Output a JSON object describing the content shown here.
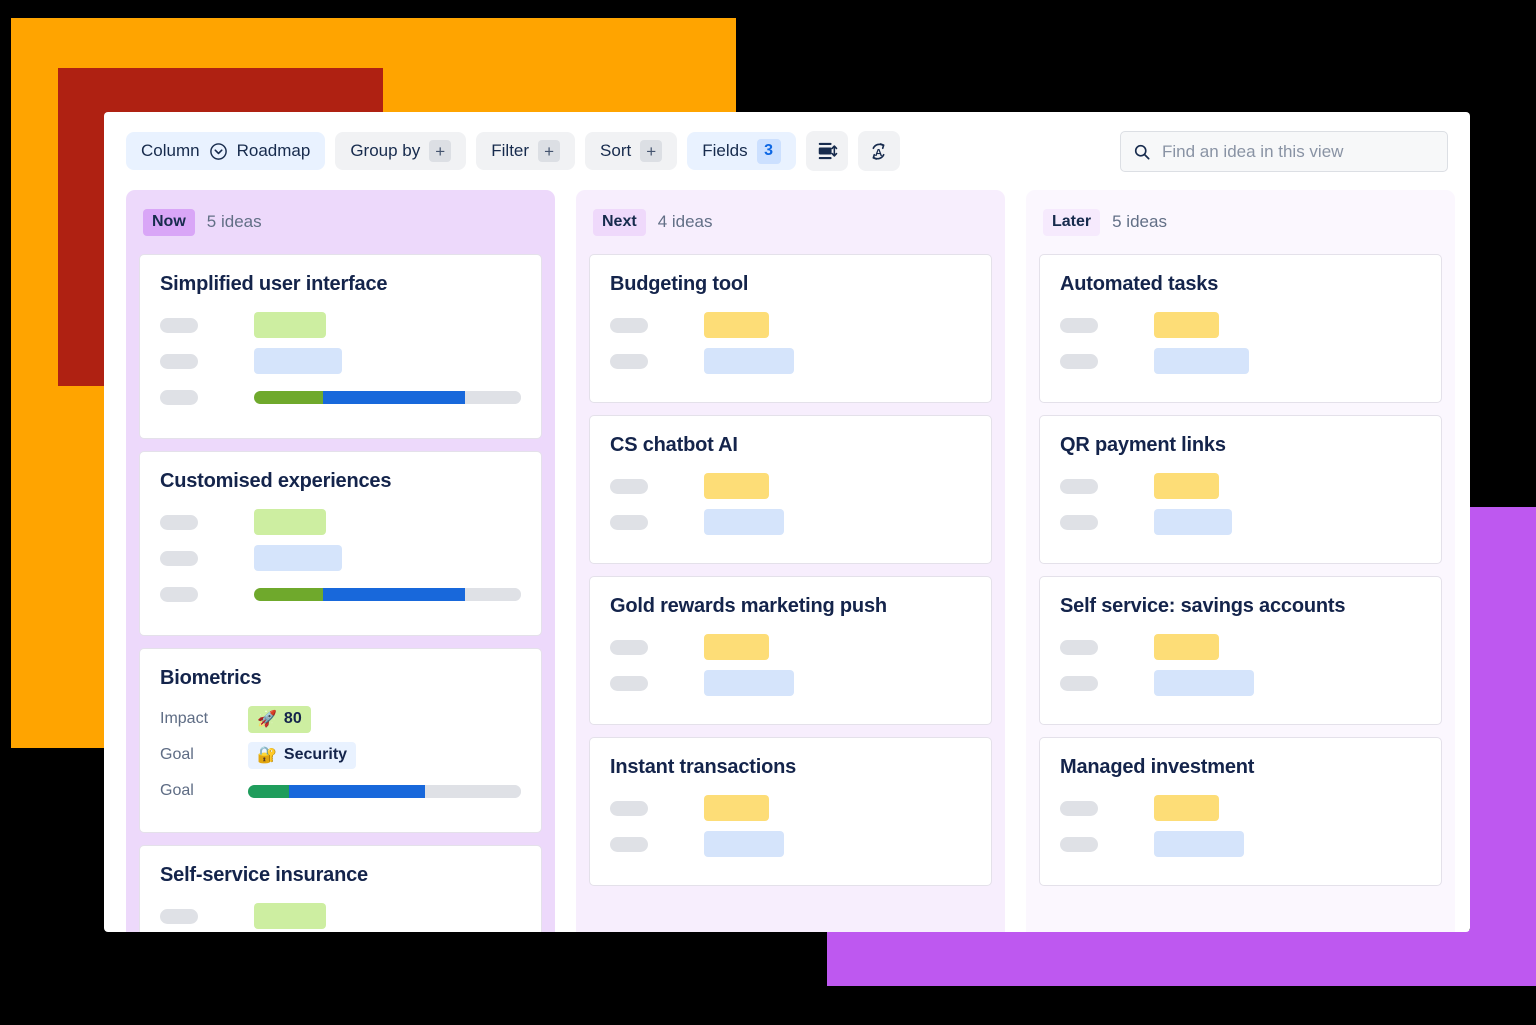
{
  "decor": {
    "orange": "#FFA400",
    "red": "#AF2112",
    "purple": "#BE58F0",
    "background": "#000000"
  },
  "toolbar": {
    "column_chip": {
      "label": "Column",
      "value": "Roadmap",
      "icon": "chevron-down-circle-icon"
    },
    "group_by": {
      "label": "Group by",
      "add": "+"
    },
    "filter": {
      "label": "Filter",
      "add": "+"
    },
    "sort": {
      "label": "Sort",
      "add": "+"
    },
    "fields": {
      "label": "Fields",
      "count": "3"
    },
    "row_height_icon": "row-height-icon",
    "translate_icon": "auto-translate-icon",
    "search": {
      "icon": "search-icon",
      "placeholder": "Find an idea in this view",
      "value": ""
    }
  },
  "board": {
    "columns": [
      {
        "key": "now",
        "badge": "Now",
        "count": "5 ideas",
        "cards": [
          {
            "title": "Simplified user interface",
            "rows": [
              {
                "label_kind": "skeleton",
                "value_kind": "pill",
                "pill_color": "green",
                "pill_width": 72
              },
              {
                "label_kind": "skeleton",
                "value_kind": "pill",
                "pill_color": "blue",
                "pill_width": 88
              },
              {
                "label_kind": "skeleton",
                "value_kind": "progress",
                "segments": [
                  {
                    "color": "green",
                    "pct": 26
                  },
                  {
                    "color": "blue",
                    "pct": 53
                  },
                  {
                    "color": "rest",
                    "pct": 21
                  }
                ]
              }
            ]
          },
          {
            "title": "Customised experiences",
            "rows": [
              {
                "label_kind": "skeleton",
                "value_kind": "pill",
                "pill_color": "green",
                "pill_width": 72
              },
              {
                "label_kind": "skeleton",
                "value_kind": "pill",
                "pill_color": "blue",
                "pill_width": 88
              },
              {
                "label_kind": "skeleton",
                "value_kind": "progress",
                "segments": [
                  {
                    "color": "green",
                    "pct": 26
                  },
                  {
                    "color": "blue",
                    "pct": 53
                  },
                  {
                    "color": "rest",
                    "pct": 21
                  }
                ]
              }
            ]
          },
          {
            "title": "Biometrics",
            "rows": [
              {
                "label_kind": "text",
                "label": "Impact",
                "value_kind": "tag",
                "tag_color": "green",
                "emoji": "🚀",
                "tag_text": "80"
              },
              {
                "label_kind": "text",
                "label": "Goal",
                "value_kind": "tag",
                "tag_color": "blue",
                "emoji": "🔐",
                "tag_text": "Security"
              },
              {
                "label_kind": "text",
                "label": "Goal",
                "value_kind": "progress",
                "segments": [
                  {
                    "color": "teal",
                    "pct": 15
                  },
                  {
                    "color": "blue",
                    "pct": 50
                  },
                  {
                    "color": "rest",
                    "pct": 35
                  }
                ]
              }
            ]
          },
          {
            "title": "Self-service insurance",
            "rows": [
              {
                "label_kind": "skeleton",
                "value_kind": "pill",
                "pill_color": "green",
                "pill_width": 72
              },
              {
                "label_kind": "skeleton",
                "value_kind": "pill",
                "pill_color": "blue",
                "pill_width": 88
              }
            ]
          }
        ]
      },
      {
        "key": "next",
        "badge": "Next",
        "count": "4 ideas",
        "cards": [
          {
            "title": "Budgeting tool",
            "rows": [
              {
                "label_kind": "skeleton",
                "value_kind": "pill",
                "pill_color": "yellow",
                "pill_width": 65
              },
              {
                "label_kind": "skeleton",
                "value_kind": "pill",
                "pill_color": "blue",
                "pill_width": 90
              }
            ]
          },
          {
            "title": "CS chatbot AI",
            "rows": [
              {
                "label_kind": "skeleton",
                "value_kind": "pill",
                "pill_color": "yellow",
                "pill_width": 65
              },
              {
                "label_kind": "skeleton",
                "value_kind": "pill",
                "pill_color": "blue",
                "pill_width": 80
              }
            ]
          },
          {
            "title": "Gold rewards marketing push",
            "rows": [
              {
                "label_kind": "skeleton",
                "value_kind": "pill",
                "pill_color": "yellow",
                "pill_width": 65
              },
              {
                "label_kind": "skeleton",
                "value_kind": "pill",
                "pill_color": "blue",
                "pill_width": 90
              }
            ]
          },
          {
            "title": "Instant transactions",
            "rows": [
              {
                "label_kind": "skeleton",
                "value_kind": "pill",
                "pill_color": "yellow",
                "pill_width": 65
              },
              {
                "label_kind": "skeleton",
                "value_kind": "pill",
                "pill_color": "blue",
                "pill_width": 80
              }
            ]
          }
        ]
      },
      {
        "key": "later",
        "badge": "Later",
        "count": "5 ideas",
        "cards": [
          {
            "title": "Automated tasks",
            "rows": [
              {
                "label_kind": "skeleton",
                "value_kind": "pill",
                "pill_color": "yellow",
                "pill_width": 65
              },
              {
                "label_kind": "skeleton",
                "value_kind": "pill",
                "pill_color": "blue",
                "pill_width": 95
              }
            ]
          },
          {
            "title": "QR payment links",
            "rows": [
              {
                "label_kind": "skeleton",
                "value_kind": "pill",
                "pill_color": "yellow",
                "pill_width": 65
              },
              {
                "label_kind": "skeleton",
                "value_kind": "pill",
                "pill_color": "blue",
                "pill_width": 78
              }
            ]
          },
          {
            "title": "Self service: savings accounts",
            "rows": [
              {
                "label_kind": "skeleton",
                "value_kind": "pill",
                "pill_color": "yellow",
                "pill_width": 65
              },
              {
                "label_kind": "skeleton",
                "value_kind": "pill",
                "pill_color": "blue",
                "pill_width": 100
              }
            ]
          },
          {
            "title": "Managed investment",
            "rows": [
              {
                "label_kind": "skeleton",
                "value_kind": "pill",
                "pill_color": "yellow",
                "pill_width": 65
              },
              {
                "label_kind": "skeleton",
                "value_kind": "pill",
                "pill_color": "blue",
                "pill_width": 90
              }
            ]
          }
        ]
      }
    ]
  }
}
